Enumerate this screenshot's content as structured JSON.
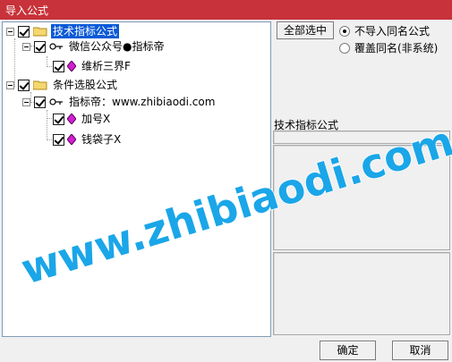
{
  "window": {
    "title": "导入公式",
    "accent": "#c8323a"
  },
  "tree": {
    "nodes": [
      {
        "label": "技术指标公式",
        "selected": true
      },
      {
        "label": "微信公众号●指标帝"
      },
      {
        "label": "维析三界F"
      },
      {
        "label": "条件选股公式"
      },
      {
        "label": "指标帝：www.zhibiaodi.com"
      },
      {
        "label": "加号X"
      },
      {
        "label": "钱袋子X"
      }
    ]
  },
  "options": {
    "select_all_label": "全部选中",
    "radio_1": "不导入同名公式",
    "radio_2": "覆盖同名(非系统)"
  },
  "info": {
    "section_label": "技术指标公式"
  },
  "footer": {
    "ok_label": "确定",
    "cancel_label": "取消"
  },
  "watermark": {
    "text": "www.zhibiaodi.com",
    "color": "#1aa6e8"
  }
}
